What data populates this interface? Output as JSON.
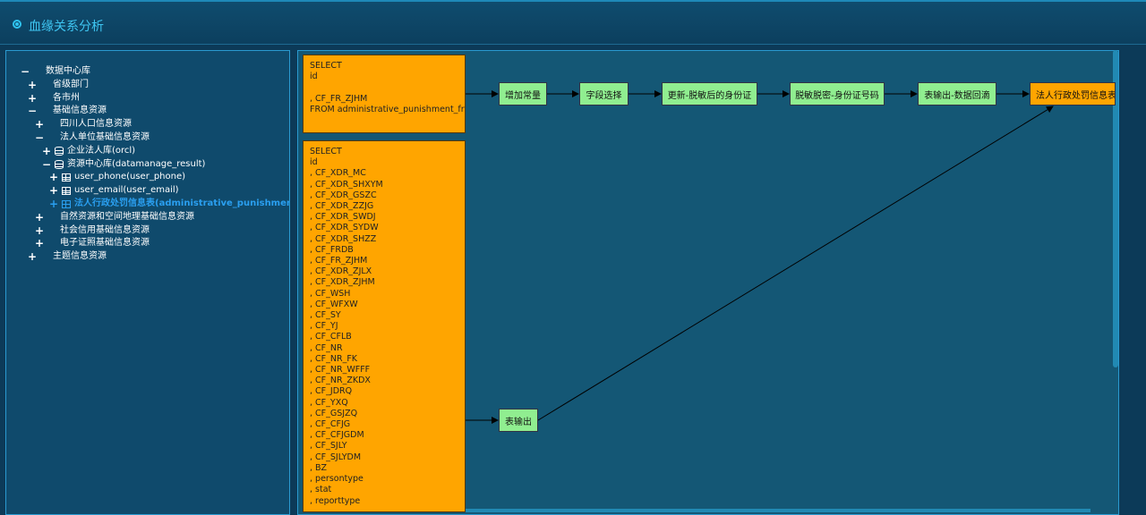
{
  "header": {
    "title": "血缘关系分析"
  },
  "tree": [
    {
      "label": "数据中心库",
      "toggle": "−",
      "icon": "grid",
      "level": 0
    },
    {
      "label": "省级部门",
      "toggle": "+",
      "icon": "grid",
      "level": 1
    },
    {
      "label": "各市州",
      "toggle": "+",
      "icon": "grid",
      "level": 1
    },
    {
      "label": "基础信息资源",
      "toggle": "−",
      "icon": "grid",
      "level": 1
    },
    {
      "label": "四川人口信息资源",
      "toggle": "+",
      "icon": "grid",
      "level": 2
    },
    {
      "label": "法人单位基础信息资源",
      "toggle": "−",
      "icon": "grid",
      "level": 2
    },
    {
      "label": "企业法人库(orcl)",
      "toggle": "+",
      "icon": "db",
      "level": 3
    },
    {
      "label": "资源中心库(datamanage_result)",
      "toggle": "−",
      "icon": "db",
      "level": 3
    },
    {
      "label": "user_phone(user_phone)",
      "toggle": "+",
      "icon": "table",
      "level": 4
    },
    {
      "label": "user_email(user_email)",
      "toggle": "+",
      "icon": "table",
      "level": 4
    },
    {
      "label": "法人行政处罚信息表(administrative_punishment",
      "toggle": "+",
      "icon": "table",
      "level": 4,
      "selected": true
    },
    {
      "label": "自然资源和空间地理基础信息资源",
      "toggle": "+",
      "icon": "grid",
      "level": 2
    },
    {
      "label": "社会信用基础信息资源",
      "toggle": "+",
      "icon": "grid",
      "level": 2
    },
    {
      "label": "电子证照基础信息资源",
      "toggle": "+",
      "icon": "grid",
      "level": 2
    },
    {
      "label": "主题信息资源",
      "toggle": "+",
      "icon": "grid",
      "level": 1
    }
  ],
  "flow": {
    "sql1": "SELECT\nid\n\n, CF_FR_ZJHM\nFROM administrative_punishment_fr",
    "sql2": "SELECT\nid\n, CF_XDR_MC\n, CF_XDR_SHXYM\n, CF_XDR_GSZC\n, CF_XDR_ZZJG\n, CF_XDR_SWDJ\n, CF_XDR_SYDW\n, CF_XDR_SHZZ\n, CF_FRDB\n, CF_FR_ZJHM\n, CF_XDR_ZJLX\n, CF_XDR_ZJHM\n, CF_WSH\n, CF_WFXW\n, CF_SY\n, CF_YJ\n, CF_CFLB\n, CF_NR\n, CF_NR_FK\n, CF_NR_WFFF\n, CF_NR_ZKDX\n, CF_JDRQ\n, CF_YXQ\n, CF_GSJZQ\n, CF_CFJG\n, CF_CFJGDM\n, CF_SJLY\n, CF_SJLYDM\n, BZ\n, persontype\n, stat\n, reporttype",
    "steps": [
      "增加常量",
      "字段选择",
      "更新-脱敏后的身份证",
      "脱敏脱密-身份证号码",
      "表输出-数据回滴"
    ],
    "output2": "表输出",
    "target": "法人行政处罚信息表"
  },
  "colors": {
    "accent": "#3ec6f2",
    "sql_box": "#ffa500",
    "step_box": "#90ee90",
    "selected": "#2a9ff0"
  }
}
